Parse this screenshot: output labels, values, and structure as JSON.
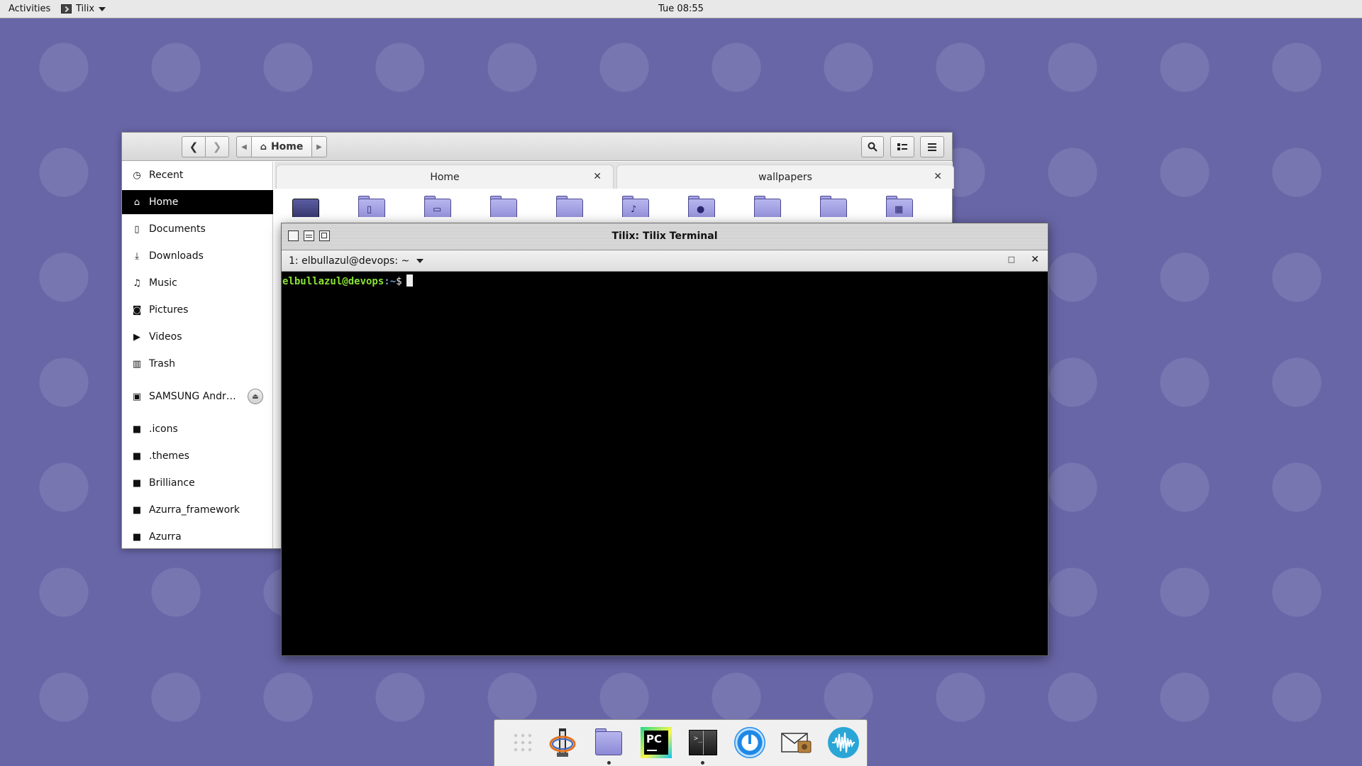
{
  "top_panel": {
    "activities": "Activities",
    "app_name": "Tilix",
    "clock": "Tue 08:55"
  },
  "file_manager": {
    "path_current": "Home",
    "sidebar": [
      {
        "label": "Recent",
        "icon": "clock-icon"
      },
      {
        "label": "Home",
        "icon": "home-icon"
      },
      {
        "label": "Documents",
        "icon": "document-icon"
      },
      {
        "label": "Downloads",
        "icon": "download-icon"
      },
      {
        "label": "Music",
        "icon": "music-icon"
      },
      {
        "label": "Pictures",
        "icon": "camera-icon"
      },
      {
        "label": "Videos",
        "icon": "video-icon"
      },
      {
        "label": "Trash",
        "icon": "trash-icon"
      },
      {
        "label": "SAMSUNG Andr…",
        "icon": "drive-icon"
      },
      {
        "label": ".icons",
        "icon": "folder-icon"
      },
      {
        "label": ".themes",
        "icon": "folder-icon"
      },
      {
        "label": "Brilliance",
        "icon": "folder-icon"
      },
      {
        "label": "Azurra_framework",
        "icon": "folder-icon"
      },
      {
        "label": "Azurra",
        "icon": "folder-icon"
      }
    ],
    "tabs": [
      {
        "label": "Home"
      },
      {
        "label": "wallpapers"
      }
    ]
  },
  "terminal": {
    "title": "Tilix: Tilix Terminal",
    "session": "1: elbullazul@devops: ~",
    "prompt_user": "elbullazul@devops",
    "prompt_path": ":~",
    "prompt_symbol": "$"
  },
  "dock": {
    "items": [
      "app-grid-icon",
      "java-icon",
      "files-icon",
      "pycharm-icon",
      "tilix-icon",
      "update-icon",
      "mail-icon",
      "audio-icon"
    ],
    "pycharm_text": "PC"
  },
  "colors": {
    "desktop": "#6966a8",
    "prompt_user": "#8ae234",
    "prompt_path": "#729fcf"
  }
}
